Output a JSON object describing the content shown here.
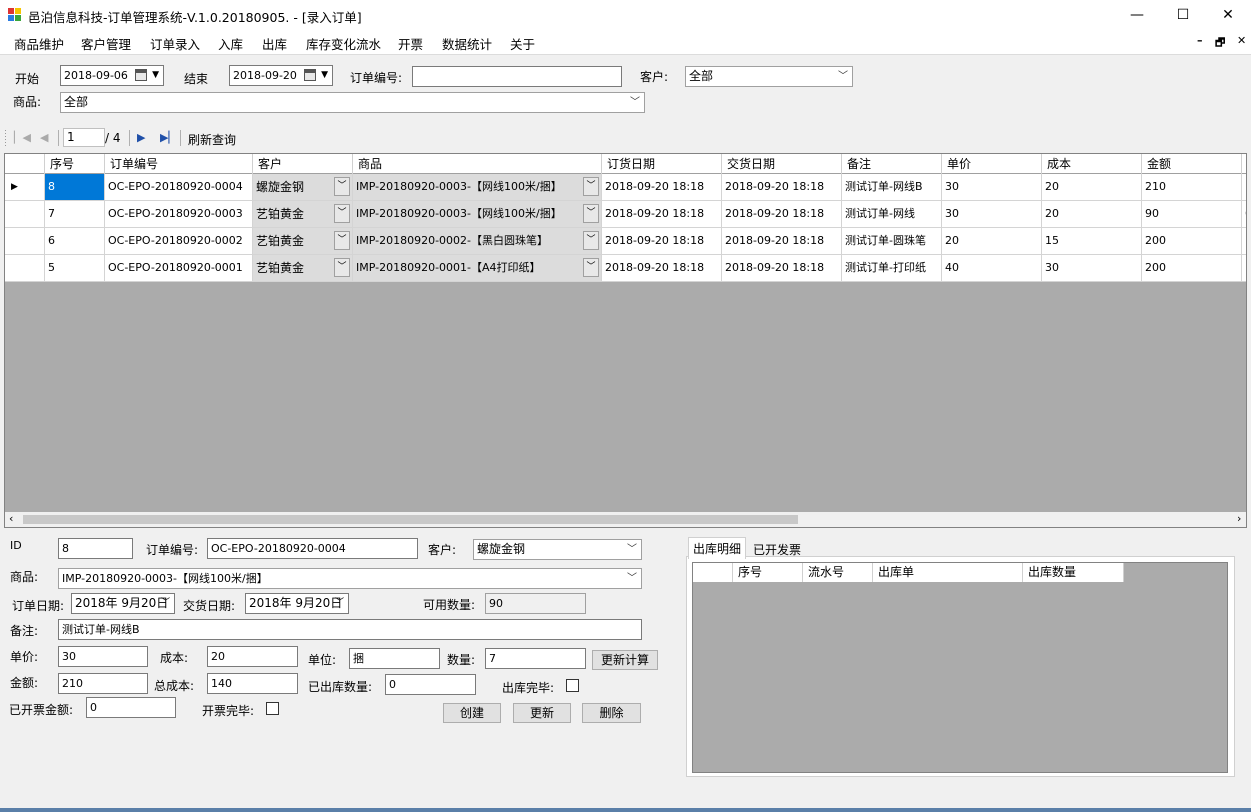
{
  "window": {
    "title": "邑泊信息科技-订单管理系统-V.1.0.20180905. - [录入订单]",
    "controls": {
      "minimize": "—",
      "maximize": "☐",
      "close": "✕"
    }
  },
  "menu": {
    "items": [
      "商品维护",
      "客户管理",
      "订单录入",
      "入库",
      "出库",
      "库存变化流水",
      "开票",
      "数据统计",
      "关于"
    ],
    "mdi": {
      "minimize": "–",
      "restore": "🗗",
      "close": "✕"
    }
  },
  "filter": {
    "start_label": "开始",
    "start_date": "2018-09-06",
    "end_label": "结束",
    "end_date": "2018-09-20",
    "order_no_label": "订单编号:",
    "order_no_value": "",
    "customer_label": "客户:",
    "customer_value": "全部",
    "product_label": "商品:",
    "product_value": "全部"
  },
  "navigator": {
    "position": "1",
    "total": "/ 4",
    "refresh_label": "刷新查询"
  },
  "grid": {
    "columns": [
      "序号",
      "订单编号",
      "客户",
      "商品",
      "订货日期",
      "交货日期",
      "备注",
      "单价",
      "成本",
      "金额"
    ],
    "rows": [
      {
        "seq": "8",
        "order_no": "OC-EPO-20180920-0004",
        "customer": "螺旋金钢",
        "product": "IMP-20180920-0003-【网线100米/捆】",
        "order_date": "2018-09-20 18:18",
        "delivery_date": "2018-09-20 18:18",
        "note": "测试订单-网线B",
        "price": "30",
        "cost": "20",
        "amount": "210",
        "extra": "1"
      },
      {
        "seq": "7",
        "order_no": "OC-EPO-20180920-0003",
        "customer": "艺铂黄金",
        "product": "IMP-20180920-0003-【网线100米/捆】",
        "order_date": "2018-09-20 18:18",
        "delivery_date": "2018-09-20 18:18",
        "note": "测试订单-网线",
        "price": "30",
        "cost": "20",
        "amount": "90",
        "extra": "6"
      },
      {
        "seq": "6",
        "order_no": "OC-EPO-20180920-0002",
        "customer": "艺铂黄金",
        "product": "IMP-20180920-0002-【黑白圆珠笔】",
        "order_date": "2018-09-20 18:18",
        "delivery_date": "2018-09-20 18:18",
        "note": "测试订单-圆珠笔",
        "price": "20",
        "cost": "15",
        "amount": "200",
        "extra": "1"
      },
      {
        "seq": "5",
        "order_no": "OC-EPO-20180920-0001",
        "customer": "艺铂黄金",
        "product": "IMP-20180920-0001-【A4打印纸】",
        "order_date": "2018-09-20 18:18",
        "delivery_date": "2018-09-20 18:18",
        "note": "测试订单-打印纸",
        "price": "40",
        "cost": "30",
        "amount": "200",
        "extra": "1"
      }
    ]
  },
  "detail": {
    "id_label": "ID",
    "id_value": "8",
    "order_no_label": "订单编号:",
    "order_no_value": "OC-EPO-20180920-0004",
    "customer_label": "客户:",
    "customer_value": "螺旋金钢",
    "product_label": "商品:",
    "product_value": "IMP-20180920-0003-【网线100米/捆】",
    "order_date_label": "订单日期:",
    "order_date_value": "2018年 9月20日",
    "delivery_date_label": "交货日期:",
    "delivery_date_value": "2018年 9月20日",
    "available_qty_label": "可用数量:",
    "available_qty_value": "90",
    "note_label": "备注:",
    "note_value": "测试订单-网线B",
    "price_label": "单价:",
    "price_value": "30",
    "cost_label": "成本:",
    "cost_value": "20",
    "unit_label": "单位:",
    "unit_value": "捆",
    "qty_label": "数量:",
    "qty_value": "7",
    "recalc_button": "更新计算",
    "amount_label": "金额:",
    "amount_value": "210",
    "total_cost_label": "总成本:",
    "total_cost_value": "140",
    "shipped_qty_label": "已出库数量:",
    "shipped_qty_value": "0",
    "ship_done_label": "出库完毕:",
    "invoiced_amount_label": "已开票金额:",
    "invoiced_amount_value": "0",
    "invoice_done_label": "开票完毕:",
    "create_button": "创建",
    "update_button": "更新",
    "delete_button": "删除"
  },
  "tabs": {
    "items": [
      "出库明细",
      "已开发票"
    ],
    "subgrid_columns": [
      "序号",
      "流水号",
      "出库单",
      "出库数量"
    ]
  }
}
